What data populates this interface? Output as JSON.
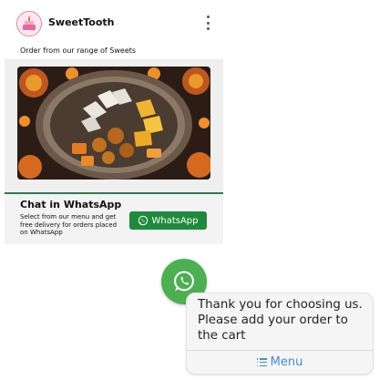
{
  "header": {
    "brand": "SweetTooth",
    "subtitle": "Order from our range of Sweets"
  },
  "chat_section": {
    "title": "Chat in WhatsApp",
    "description": "Select from our menu and get free delivery for orders placed on WhatsApp",
    "button_label": "WhatsApp"
  },
  "bubble": {
    "message": "Thank you for choosing us. Please add your order to the cart",
    "menu_label": "Menu"
  },
  "colors": {
    "whatsapp_button": "#1e8a3c",
    "fab": "#4caf50",
    "menu_link": "#3d8fd6",
    "divider": "#2e7d4f"
  }
}
